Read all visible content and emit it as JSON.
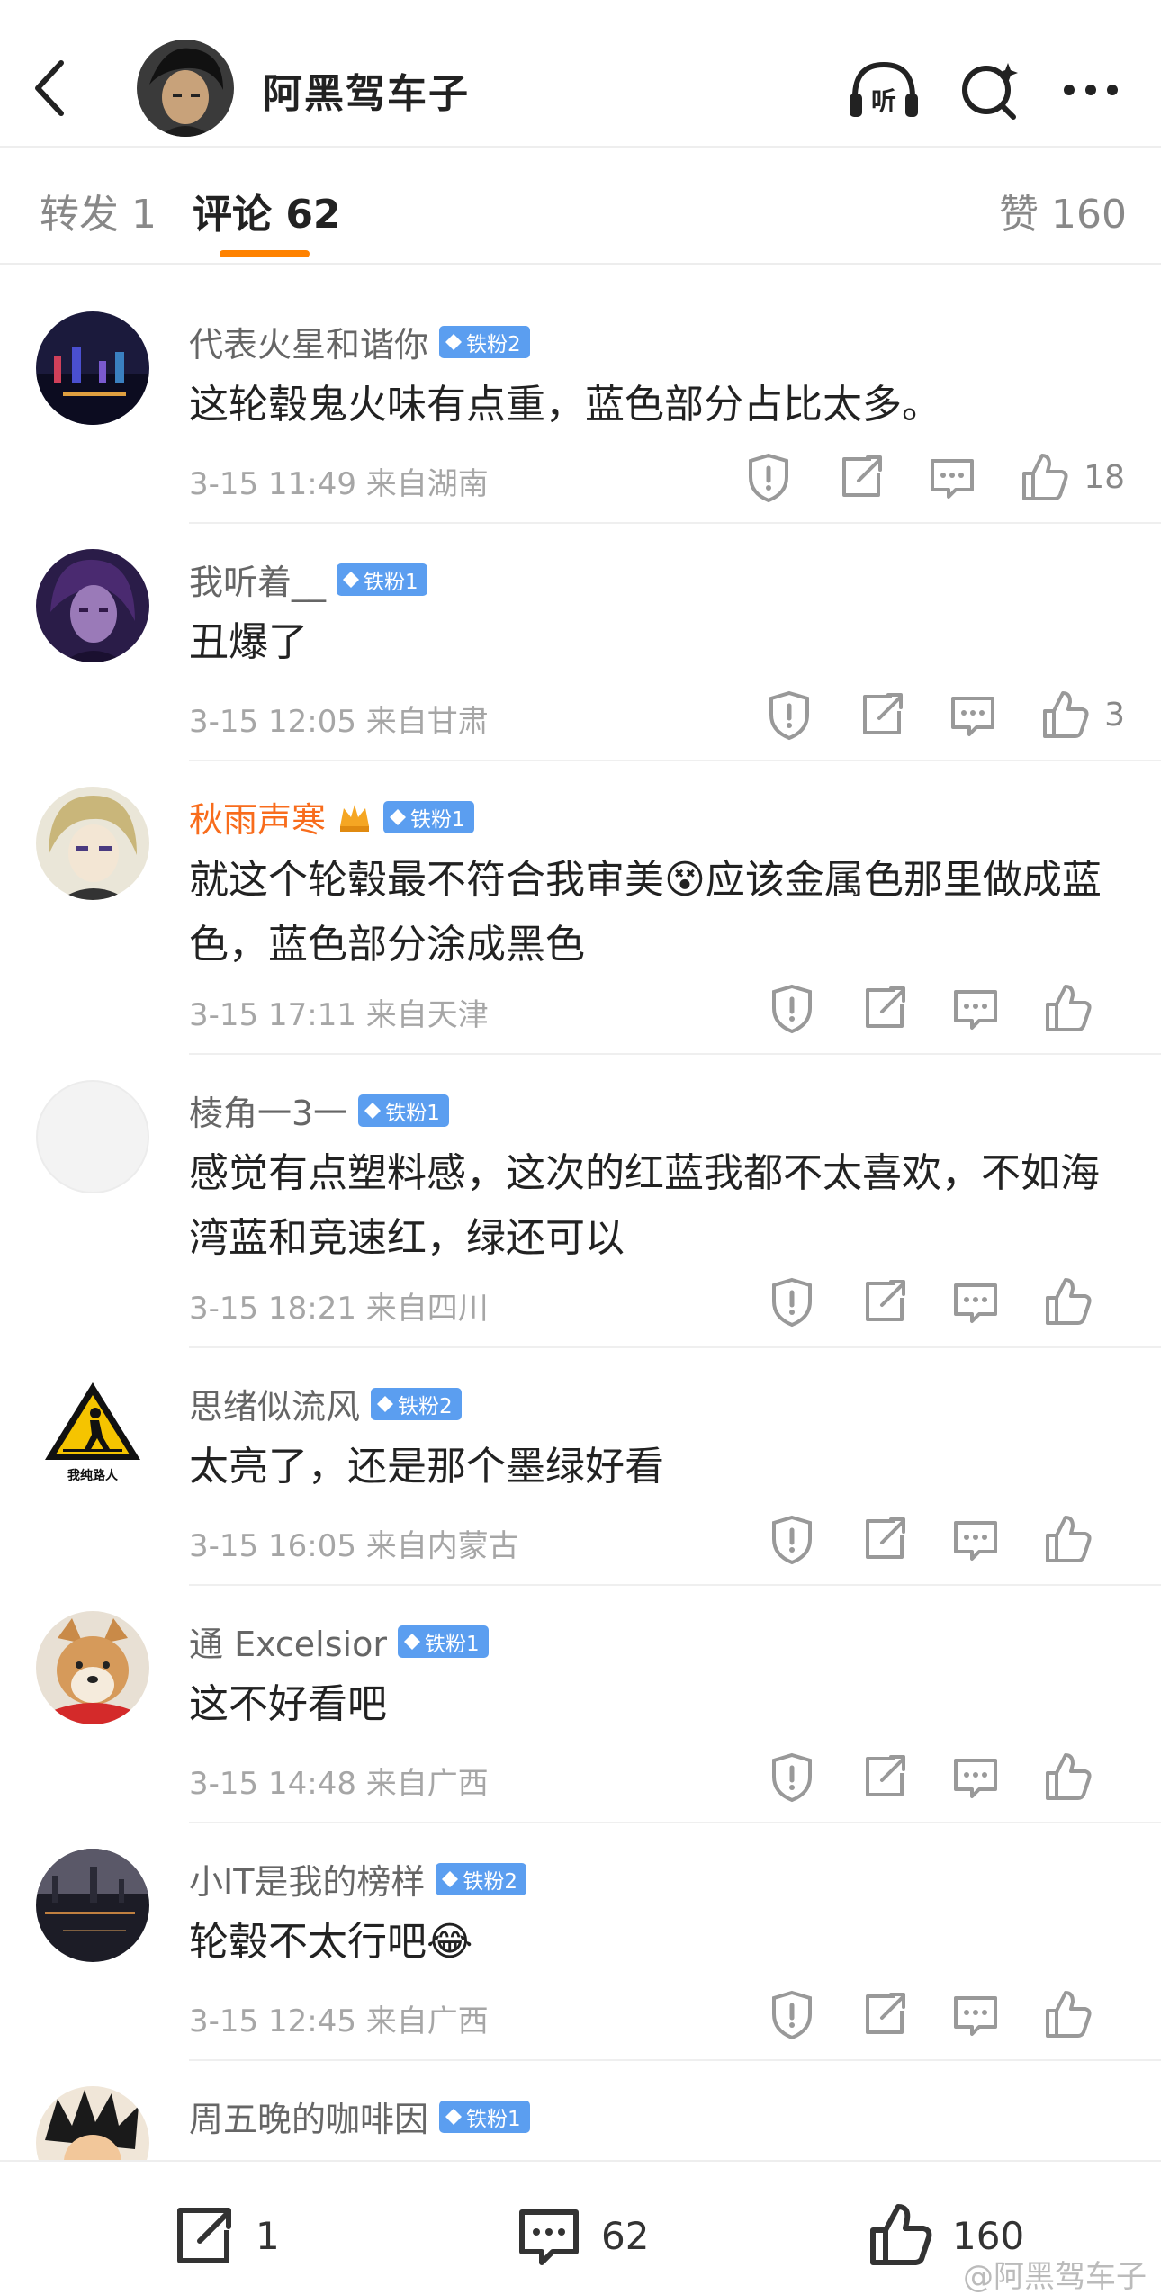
{
  "header": {
    "title": "阿黑驾车子",
    "listen_label": "听"
  },
  "tabs": {
    "repost": "转发 1",
    "comments": "评论 62",
    "likes": "赞 160"
  },
  "comments": [
    {
      "name": "代表火星和谐你",
      "vip": false,
      "crown": false,
      "badge": "铁粉2",
      "text": "这轮毂鬼火味有点重，蓝色部分占比太多。",
      "meta": "3-15 11:49  来自湖南",
      "likes": "18"
    },
    {
      "name": "我听着__",
      "vip": false,
      "crown": false,
      "badge": "铁粉1",
      "text": "丑爆了",
      "meta": "3-15 12:05  来自甘肃",
      "likes": "3"
    },
    {
      "name": "秋雨声寒",
      "vip": true,
      "crown": true,
      "badge": "铁粉1",
      "text": "就这个轮毂最不符合我审美😵应该金属色那里做成蓝色，蓝色部分涂成黑色",
      "meta": "3-15 17:11  来自天津",
      "likes": ""
    },
    {
      "name": "棱角一3一",
      "vip": false,
      "crown": false,
      "badge": "铁粉1",
      "text": "感觉有点塑料感，这次的红蓝我都不太喜欢，不如海湾蓝和竞速红，绿还可以",
      "meta": "3-15 18:21  来自四川",
      "likes": ""
    },
    {
      "name": "思绪似流风",
      "vip": false,
      "crown": false,
      "badge": "铁粉2",
      "text": "太亮了，还是那个墨绿好看",
      "meta": "3-15 16:05  来自内蒙古",
      "likes": "",
      "avatar_text": "我纯路人"
    },
    {
      "name": "通 Excelsior",
      "vip": false,
      "crown": false,
      "badge": "铁粉1",
      "text": "这不好看吧",
      "meta": "3-15 14:48  来自广西",
      "likes": ""
    },
    {
      "name": "小IT是我的榜样",
      "vip": false,
      "crown": false,
      "badge": "铁粉2",
      "text": "轮毂不太行吧😂",
      "meta": "3-15 12:45  来自广西",
      "likes": ""
    },
    {
      "name": "周五晚的咖啡因",
      "vip": false,
      "crown": false,
      "badge": "铁粉1",
      "text": "",
      "meta": "",
      "likes": ""
    }
  ],
  "bottom_bar": {
    "repost_count": "1",
    "comment_count": "62",
    "like_count": "160",
    "watermark": "@阿黑驾车子"
  },
  "colors": {
    "accent": "#ff8200",
    "badge": "#5b9ef0",
    "vip_name": "#f86c1c"
  }
}
